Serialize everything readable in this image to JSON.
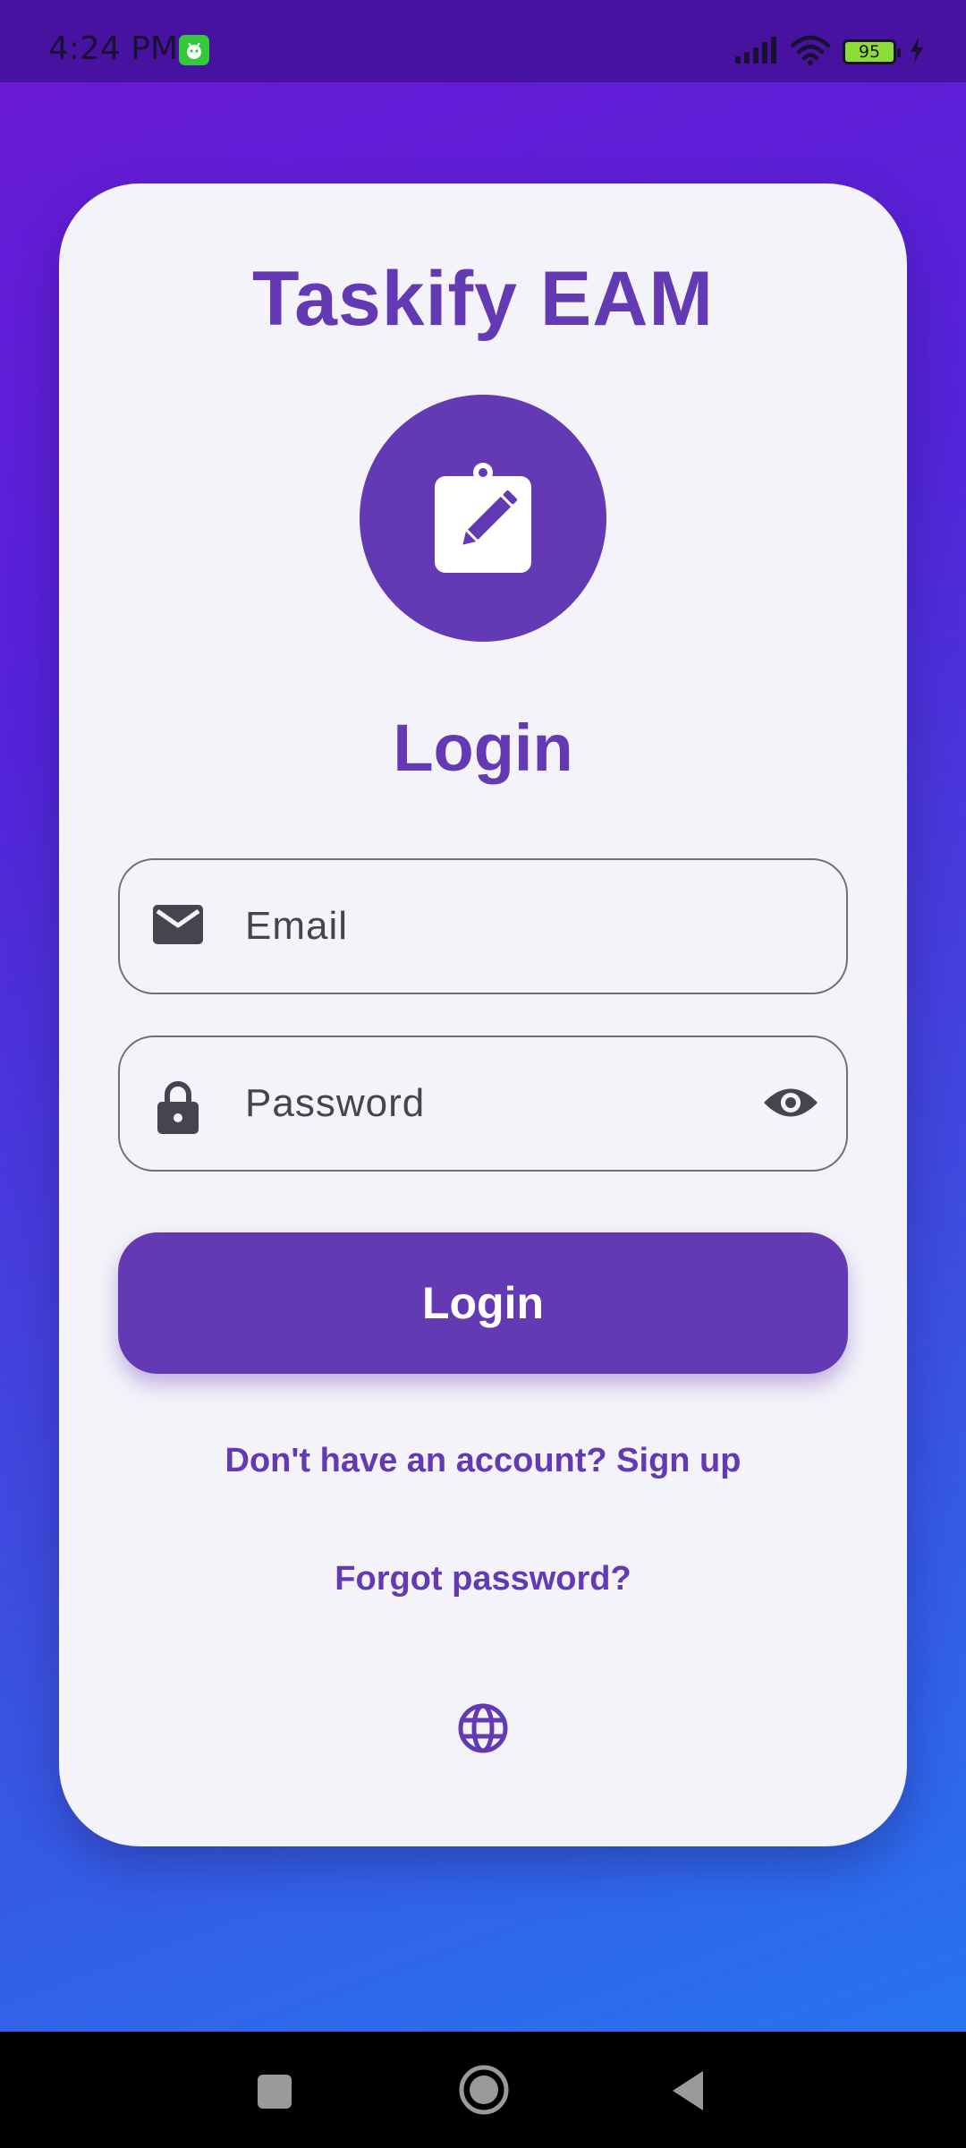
{
  "status_bar": {
    "time": "4:24 PM",
    "battery_level": "95"
  },
  "app": {
    "title": "Taskify EAM",
    "logo_icon": "clipboard-edit-icon",
    "heading": "Login"
  },
  "form": {
    "email": {
      "placeholder": "Email",
      "value": "",
      "icon": "email-icon"
    },
    "password": {
      "placeholder": "Password",
      "value": "",
      "icon": "lock-icon",
      "toggle_icon": "eye-icon"
    },
    "submit_label": "Login"
  },
  "links": {
    "signup": "Don't have an account? Sign up",
    "forgot": "Forgot password?"
  },
  "language_icon": "globe-icon",
  "colors": {
    "primary": "#6439b4",
    "card_background": "#f3f3f9",
    "gradient_start": "#6b19d6",
    "gradient_end": "#2479f3"
  }
}
